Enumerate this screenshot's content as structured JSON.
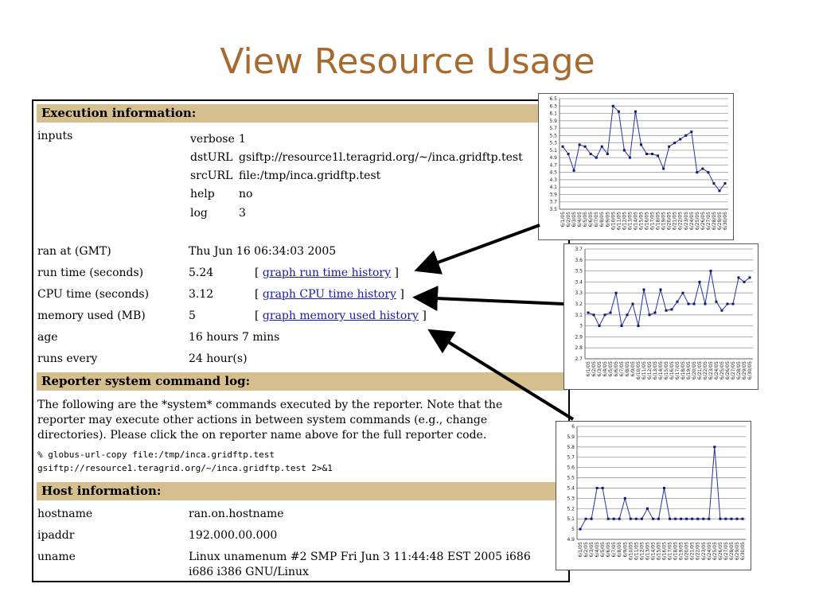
{
  "slide": {
    "title": "View Resource Usage"
  },
  "execution": {
    "header": "Execution information:",
    "inputs_label": "inputs",
    "inputs": [
      {
        "key": "verbose",
        "value": "1"
      },
      {
        "key": "dstURL",
        "value": "gsiftp://resource1l.teragrid.org/~/inca.gridftp.test"
      },
      {
        "key": "srcURL",
        "value": "file:/tmp/inca.gridftp.test"
      },
      {
        "key": "help",
        "value": "no"
      },
      {
        "key": "log",
        "value": "3"
      }
    ],
    "ran_at_label": "ran at (GMT)",
    "ran_at": "Thu Jun 16 06:34:03 2005",
    "run_time_label": "run time (seconds)",
    "run_time": "5.24",
    "run_time_link": "graph run time history",
    "cpu_time_label": "CPU time (seconds)",
    "cpu_time": "3.12",
    "cpu_time_link": "graph CPU time history",
    "memory_label": "memory used (MB)",
    "memory": "5",
    "memory_link": "graph memory used history",
    "bracket_open": "[",
    "bracket_close": "]",
    "age_label": "age",
    "age": "16 hours 7 mins",
    "runs_every_label": "runs every",
    "runs_every": "24 hour(s)"
  },
  "command_log": {
    "header": "Reporter system command log:",
    "description": "The following are the *system* commands executed by the reporter. Note that the reporter may execute other actions in between system commands (e.g., change directories). Please click the on reporter name above for the full reporter code.",
    "command_line1": "% globus-url-copy file:/tmp/inca.gridftp.test",
    "command_line2": "gsiftp://resource1.teragrid.org/~/inca.gridftp.test 2>&1"
  },
  "host": {
    "header": "Host information:",
    "hostname_label": "hostname",
    "hostname": "ran.on.hostname",
    "ipaddr_label": "ipaddr",
    "ipaddr": "192.000.00.000",
    "uname_label": "uname",
    "uname_line1": "Linux unamenum #2 SMP Fri Jun 3 11:44:48 EST 2005 i686",
    "uname_line2": "i686 i386 GNU/Linux"
  },
  "chart_data": [
    {
      "type": "line",
      "x": [
        "6/1/05",
        "6/2/05",
        "6/3/05",
        "6/4/05",
        "6/5/05",
        "6/6/05",
        "6/7/05",
        "6/8/05",
        "6/9/05",
        "6/10/05",
        "6/11/05",
        "6/12/05",
        "6/13/05",
        "6/14/05",
        "6/15/05",
        "6/16/05",
        "6/17/05",
        "6/18/05",
        "6/19/05",
        "6/20/05",
        "6/21/05",
        "6/22/05",
        "6/23/05",
        "6/24/05",
        "6/25/05",
        "6/26/05",
        "6/27/05",
        "6/28/05",
        "6/29/05",
        "6/30/05"
      ],
      "values": [
        5.2,
        5.0,
        4.55,
        5.25,
        5.2,
        5.0,
        4.9,
        5.2,
        5.0,
        6.3,
        6.15,
        5.1,
        4.9,
        6.15,
        5.25,
        5.0,
        5.0,
        4.95,
        4.6,
        5.2,
        5.3,
        5.4,
        5.5,
        5.6,
        4.5,
        4.6,
        4.5,
        4.2,
        4.0,
        4.2
      ],
      "ylim": [
        3.5,
        6.5
      ],
      "yticks": [
        "3.5",
        "3.7",
        "3.9",
        "4.1",
        "4.3",
        "4.5",
        "4.7",
        "4.9",
        "5.1",
        "5.3",
        "5.5",
        "5.7",
        "5.9",
        "6.1",
        "6.3",
        "6.5"
      ],
      "color": "#2233aa"
    },
    {
      "type": "line",
      "x": [
        "6/1/05",
        "6/2/05",
        "6/3/05",
        "6/4/05",
        "6/5/05",
        "6/6/05",
        "6/7/05",
        "6/8/05",
        "6/9/05",
        "6/10/05",
        "6/11/05",
        "6/12/05",
        "6/13/05",
        "6/14/05",
        "6/15/05",
        "6/16/05",
        "6/17/05",
        "6/18/05",
        "6/19/05",
        "6/20/05",
        "6/21/05",
        "6/22/05",
        "6/23/05",
        "6/24/05",
        "6/25/05",
        "6/26/05",
        "6/27/05",
        "6/28/05",
        "6/29/05",
        "6/30/05"
      ],
      "values": [
        3.12,
        3.1,
        3.0,
        3.1,
        3.12,
        3.3,
        3.0,
        3.1,
        3.2,
        3.0,
        3.33,
        3.1,
        3.12,
        3.33,
        3.14,
        3.15,
        3.22,
        3.3,
        3.2,
        3.2,
        3.4,
        3.2,
        3.5,
        3.22,
        3.14,
        3.2,
        3.2,
        3.44,
        3.4,
        3.44
      ],
      "ylim": [
        2.7,
        3.7
      ],
      "yticks": [
        "2.7",
        "2.8",
        "2.9",
        "3",
        "3.1",
        "3.2",
        "3.3",
        "3.4",
        "3.5",
        "3.6",
        "3.7"
      ],
      "color": "#2233aa"
    },
    {
      "type": "line",
      "x": [
        "6/1/05",
        "6/2/05",
        "6/3/05",
        "6/4/05",
        "6/5/05",
        "6/6/05",
        "6/7/05",
        "6/8/05",
        "6/9/05",
        "6/10/05",
        "6/11/05",
        "6/12/05",
        "6/13/05",
        "6/14/05",
        "6/15/05",
        "6/16/05",
        "6/17/05",
        "6/18/05",
        "6/19/05",
        "6/20/05",
        "6/21/05",
        "6/22/05",
        "6/23/05",
        "6/24/05",
        "6/25/05",
        "6/26/05",
        "6/27/05",
        "6/28/05",
        "6/29/05",
        "6/30/05"
      ],
      "values": [
        5.0,
        5.1,
        5.1,
        5.4,
        5.4,
        5.1,
        5.1,
        5.1,
        5.3,
        5.1,
        5.1,
        5.1,
        5.2,
        5.1,
        5.1,
        5.4,
        5.1,
        5.1,
        5.1,
        5.1,
        5.1,
        5.1,
        5.1,
        5.1,
        5.8,
        5.1,
        5.1,
        5.1,
        5.1,
        5.1
      ],
      "ylim": [
        4.9,
        6.0
      ],
      "yticks": [
        "4.9",
        "5",
        "5.1",
        "5.2",
        "5.3",
        "5.4",
        "5.5",
        "5.6",
        "5.7",
        "5.8",
        "5.9",
        "6"
      ],
      "color": "#2233aa"
    }
  ]
}
